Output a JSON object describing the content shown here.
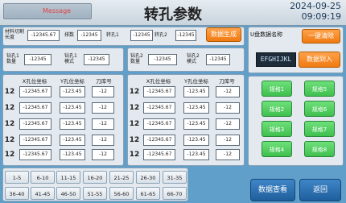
{
  "header": {
    "message": "Message",
    "title": "转孔参数",
    "date": "2024-09-25",
    "time": "09:09:19"
  },
  "top_form": {
    "material_cut_length_label": "材料切割长度",
    "material_cut_length_value": "-12345.67",
    "row_count_label": "排数",
    "row_count_value": "-12345",
    "hole1_label": "转孔1",
    "hole1_value": "-12345",
    "hole2_label": "转孔2",
    "hole2_value": "-12345",
    "generate_button": "数据生成"
  },
  "hole_params": {
    "left_count_label": "钻孔1数量",
    "left_count_value": "-12345",
    "left_mode_label": "钻孔1模式",
    "left_mode_value": "-12345",
    "right_count_label": "钻孔2数量",
    "right_count_value": "-12345",
    "right_mode_label": "钻孔2模式",
    "right_mode_value": "-12345"
  },
  "table_left": {
    "headers": [
      "X孔位坐标",
      "Y孔位坐标",
      "刀库号"
    ],
    "rows": [
      {
        "no": "12",
        "x": "-12345.67",
        "y": "-123.45",
        "tool": "-12"
      },
      {
        "no": "12",
        "x": "-12345.67",
        "y": "-123.45",
        "tool": "-12"
      },
      {
        "no": "12",
        "x": "-12345.67",
        "y": "-123.45",
        "tool": "-12"
      },
      {
        "no": "12",
        "x": "-12345.67",
        "y": "-123.45",
        "tool": "-12"
      },
      {
        "no": "12",
        "x": "-12345.67",
        "y": "-123.45",
        "tool": "-12"
      }
    ]
  },
  "table_right": {
    "headers": [
      "X孔位坐标",
      "Y孔位坐标",
      "刀库号"
    ],
    "rows": [
      {
        "no": "12",
        "x": "-12345.67",
        "y": "-123.45",
        "tool": "-12"
      },
      {
        "no": "12",
        "x": "-12345.67",
        "y": "-123.45",
        "tool": "-12"
      },
      {
        "no": "12",
        "x": "-12345.67",
        "y": "-123.45",
        "tool": "-12"
      },
      {
        "no": "12",
        "x": "-12345.67",
        "y": "-123.45",
        "tool": "-12"
      },
      {
        "no": "12",
        "x": "-12345.67",
        "y": "-123.45",
        "tool": "-12"
      }
    ]
  },
  "usb_panel": {
    "name_label": "U盘数据名称",
    "clear_button": "一键清除",
    "name_value": "EFGHIJKL",
    "import_button": "数据到入"
  },
  "specs": [
    "规格1",
    "规格5",
    "规格2",
    "规格6",
    "规格3",
    "规格7",
    "规格4",
    "规格8"
  ],
  "pages_row1": [
    "1-5",
    "6-10",
    "11-15",
    "16-20",
    "21-25",
    "26-30",
    "31-35"
  ],
  "pages_row2": [
    "36-40",
    "41-45",
    "46-50",
    "51-55",
    "56-60",
    "61-65",
    "66-70"
  ],
  "footer": {
    "view_button": "数据查看",
    "back_button": "返回"
  },
  "colors": {
    "background": "#5f9fc9",
    "accent_orange": "#f07a10",
    "spec_green": "#3fbf4e",
    "nav_blue": "#1f5e9c"
  }
}
